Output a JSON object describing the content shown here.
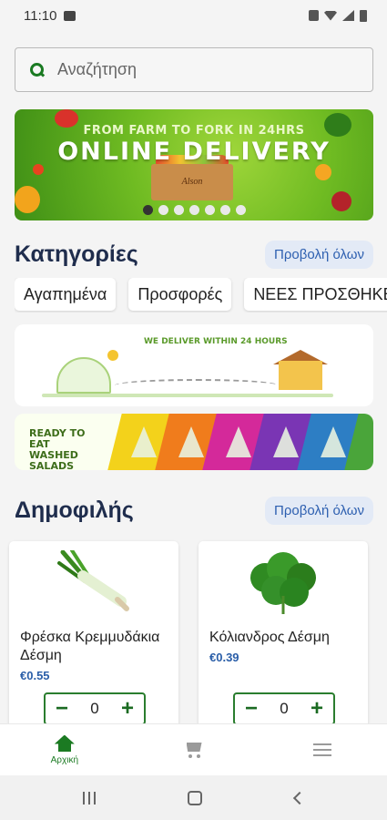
{
  "status_bar": {
    "time": "11:10"
  },
  "search": {
    "placeholder": "Αναζήτηση"
  },
  "banner": {
    "top_text": "FROM FARM TO FORK IN 24HRS",
    "main_text": "ONLINE DELIVERY",
    "crate_label": "Alson",
    "slide_count": 7,
    "active_slide": 0
  },
  "categories": {
    "title": "Κατηγορίες",
    "view_all": "Προβολή όλων",
    "chips": [
      "Αγαπημένα",
      "Προσφορές",
      "ΝΕΕΣ ΠΡΟΣΘΗΚΕΣ"
    ]
  },
  "promos": {
    "delivery_text": "WE DELIVER WITHIN 24 HOURS",
    "salads_text": "READY TO EAT WASHED SALADS"
  },
  "popular": {
    "title": "Δημοφιλής",
    "view_all": "Προβολή όλων",
    "products": [
      {
        "name": "Φρέσκα Κρεμμυδάκια Δέσμη",
        "price": "€0.55",
        "quantity": "0"
      },
      {
        "name": "Κόλιανδρος Δέσμη",
        "price": "€0.39",
        "quantity": "0"
      }
    ]
  },
  "bottom_nav": {
    "home_label": "Αρχική"
  },
  "colors": {
    "brand_green": "#1b7a22",
    "link_blue": "#2d5fb0",
    "title_navy": "#1f2d4d"
  }
}
